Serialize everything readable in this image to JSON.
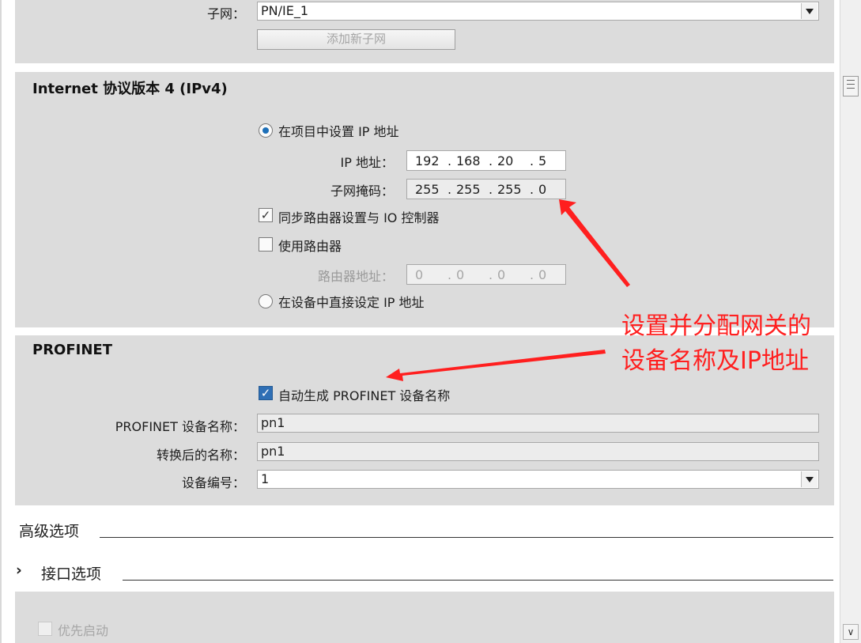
{
  "subnet": {
    "label": "子网：",
    "value": "PN/IE_1",
    "add_button": "添加新子网"
  },
  "ipv4": {
    "title": "Internet 协议版本 4 (IPv4)",
    "opt_project": "在项目中设置 IP 地址",
    "ip_label": "IP 地址：",
    "ip": [
      "192",
      "168",
      "20",
      "5"
    ],
    "mask_label": "子网掩码：",
    "mask": [
      "255",
      "255",
      "255",
      "0"
    ],
    "sync_router": "同步路由器设置与 IO 控制器",
    "use_router": "使用路由器",
    "router_label": "路由器地址：",
    "router": [
      "0",
      "0",
      "0",
      "0"
    ],
    "opt_device": "在设备中直接设定 IP 地址"
  },
  "profinet": {
    "title": "PROFINET",
    "auto_name": "自动生成 PROFINET 设备名称",
    "name_label": "PROFINET 设备名称：",
    "name_value": "pn1",
    "converted_label": "转换后的名称：",
    "converted_value": "pn1",
    "number_label": "设备编号：",
    "number_value": "1"
  },
  "advanced": {
    "title": "高级选项",
    "interface_title": "接口选项",
    "chevron": "›",
    "priority_start": "优先启动"
  },
  "annotation": {
    "line1": "设置并分配网关的",
    "line2": "设备名称及IP地址",
    "color": "#ff1f1f"
  }
}
